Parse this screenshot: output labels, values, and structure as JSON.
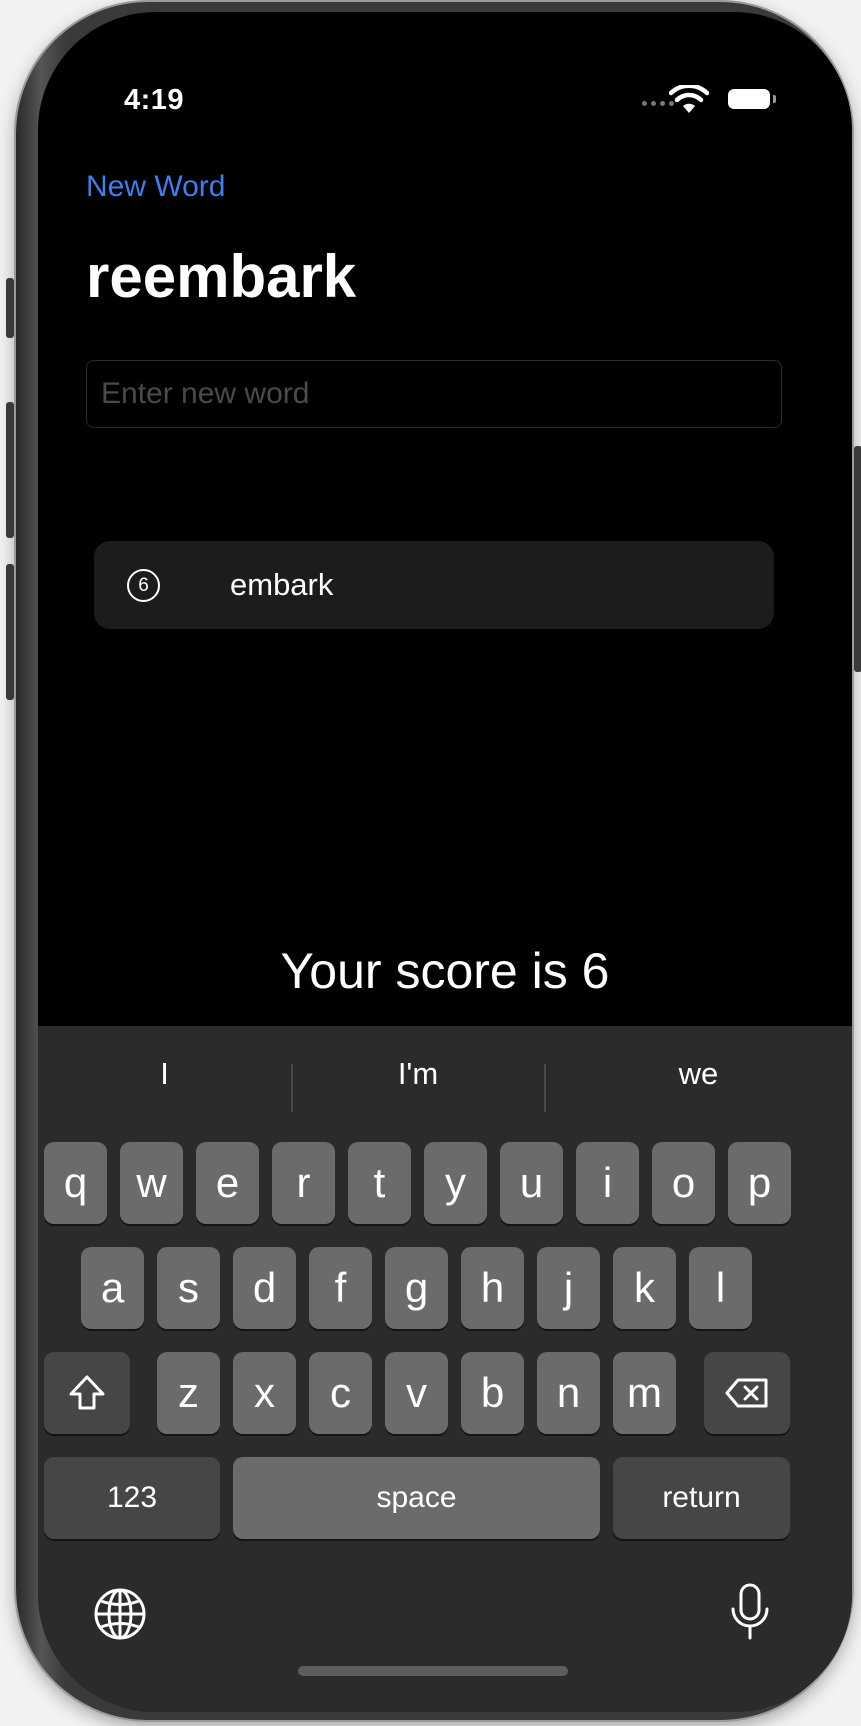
{
  "status_bar": {
    "time": "4:19"
  },
  "nav": {
    "new_word_label": "New Word"
  },
  "root_word": "reembark",
  "input": {
    "value": "",
    "placeholder": "Enter new word"
  },
  "used_words": [
    {
      "score": "6",
      "word": "embark"
    }
  ],
  "score_text": "Your score is 6",
  "keyboard": {
    "predictions": [
      "I",
      "I'm",
      "we"
    ],
    "row1": [
      "q",
      "w",
      "e",
      "r",
      "t",
      "y",
      "u",
      "i",
      "o",
      "p"
    ],
    "row2": [
      "a",
      "s",
      "d",
      "f",
      "g",
      "h",
      "j",
      "k",
      "l"
    ],
    "row3": [
      "z",
      "x",
      "c",
      "v",
      "b",
      "n",
      "m"
    ],
    "numbers_label": "123",
    "space_label": "space",
    "return_label": "return"
  },
  "icons": {
    "shift": "shift-icon",
    "delete": "delete-icon",
    "globe": "globe-icon",
    "mic": "microphone-icon",
    "wifi": "wifi-icon",
    "battery": "battery-icon"
  }
}
